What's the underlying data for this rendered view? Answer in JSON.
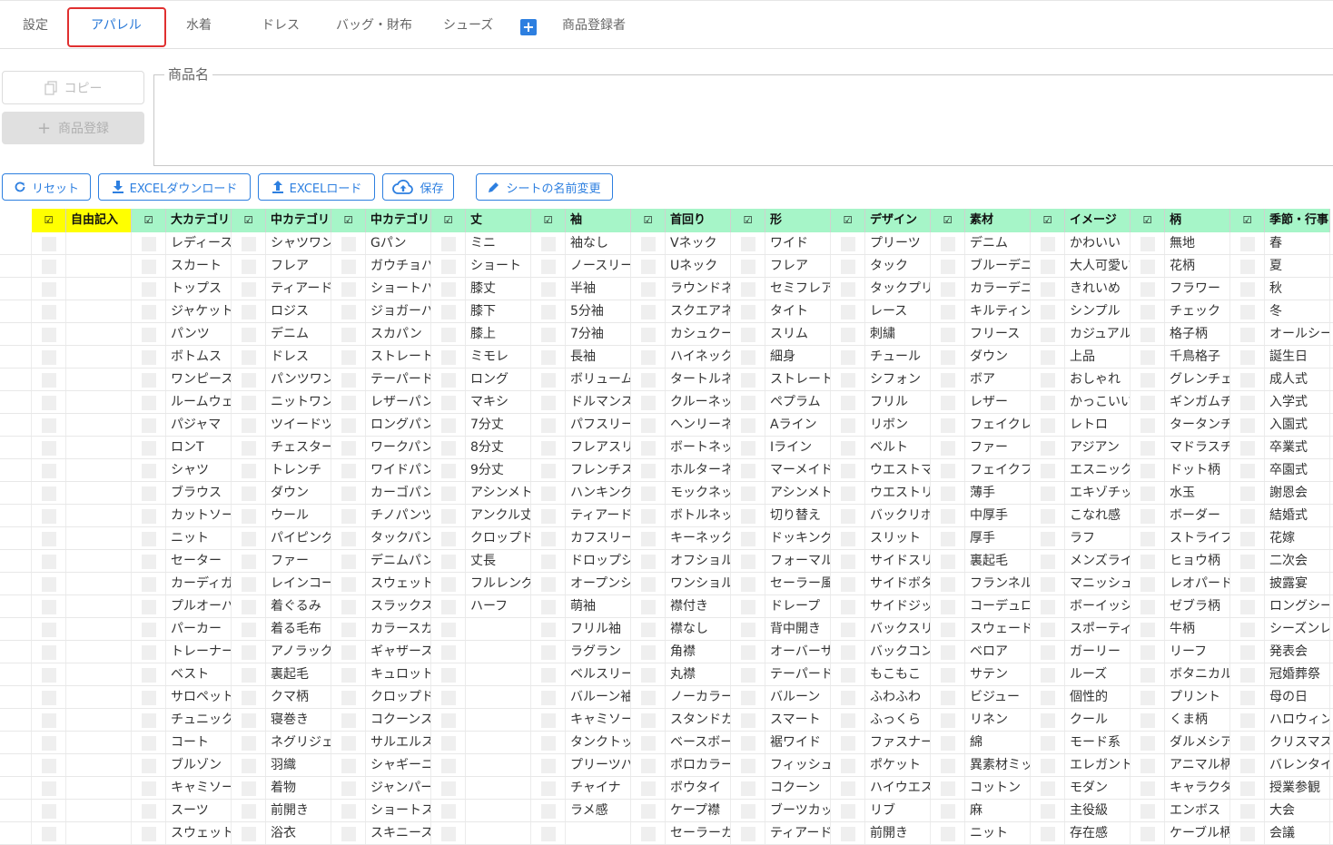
{
  "tabs": [
    "設定",
    "アパレル",
    "水着",
    "ドレス",
    "バッグ・財布",
    "シューズ",
    "商品登録者"
  ],
  "active_tab": "アパレル",
  "copy_label": "コピー",
  "register_label": "商品登録",
  "product_name_label": "商品名",
  "toolbar": {
    "reset": "リセット",
    "excel_download": "EXCELダウンロード",
    "excel_upload": "EXCELロード",
    "save": "保存",
    "rename_sheet": "シートの名前変更"
  },
  "check_mark": "☑",
  "headers": [
    "自由記入",
    "大カテゴリ",
    "中カテゴリ",
    "中カテゴリ",
    "丈",
    "袖",
    "首回り",
    "形",
    "デザイン",
    "素材",
    "イメージ",
    "柄",
    "季節・行事"
  ],
  "columns": [
    [],
    [
      "レディース",
      "スカート",
      "トップス",
      "ジャケット",
      "パンツ",
      "ボトムス",
      "ワンピース",
      "ルームウェ",
      "パジャマ",
      "ロンT",
      "シャツ",
      "ブラウス",
      "カットソー",
      "ニット",
      "セーター",
      "カーディガ",
      "プルオーバ",
      "パーカー",
      "トレーナー",
      "ベスト",
      "サロペット",
      "チュニック",
      "コート",
      "ブルゾン",
      "キャミソー",
      "スーツ",
      "スウェット"
    ],
    [
      "シャツワン",
      "フレア",
      "ティアード",
      "ロジス",
      "デニム",
      "ドレス",
      "パンツワン",
      "ニットワン",
      "ツイードツ",
      "チェスター",
      "トレンチ",
      "ダウン",
      "ウール",
      "パイピング",
      "ファー",
      "レインコー",
      "着ぐるみ",
      "着る毛布",
      "アノラック",
      "裏起毛",
      "クマ柄",
      "寝巻き",
      "ネグリジェ",
      "羽織",
      "着物",
      "前開き",
      "浴衣"
    ],
    [
      "Gパン",
      "ガウチョパ",
      "ショートパ",
      "ジョガーパ",
      "スカパン",
      "ストレート",
      "テーパード",
      "レザーパン",
      "ロングパン",
      "ワークパン",
      "ワイドパン",
      "カーゴパン",
      "チノパンツ",
      "タックパン",
      "デニムパン",
      "スウェット",
      "スラックス",
      "カラースカ",
      "ギャザース",
      "キュロット",
      "クロップド",
      "コクーンス",
      "サルエルス",
      "シャギーニ",
      "ジャンパー",
      "ショートス",
      "スキニース"
    ],
    [
      "ミニ",
      "ショート",
      "膝丈",
      "膝下",
      "膝上",
      "ミモレ",
      "ロング",
      "マキシ",
      "7分丈",
      "8分丈",
      "9分丈",
      "アシンメト",
      "アンクル丈",
      "クロップド",
      "丈長",
      "フルレング",
      "ハーフ"
    ],
    [
      "袖なし",
      "ノースリー",
      "半袖",
      "5分袖",
      "7分袖",
      "長袖",
      "ボリューム",
      "ドルマンス",
      "パフスリー",
      "フレアスリ",
      "フレンチス",
      "ハンキング",
      "ティアード",
      "カフスリー",
      "ドロップシ",
      "オープンシ",
      "萌袖",
      "フリル袖",
      "ラグラン",
      "ベルスリー",
      "バルーン袖",
      "キャミソー",
      "タンクトッ",
      "プリーツパ",
      "チャイナ",
      "ラメ感"
    ],
    [
      "Vネック",
      "Uネック",
      "ラウンドネ",
      "スクエアネ",
      "カシュクー",
      "ハイネック",
      "タートルネ",
      "クルーネッ",
      "ヘンリーネ",
      "ボートネッ",
      "ホルターネ",
      "モックネッ",
      "ボトルネッ",
      "キーネック",
      "オフショル",
      "ワンショル",
      "襟付き",
      "襟なし",
      "角襟",
      "丸襟",
      "ノーカラー",
      "スタンドカ",
      "ベースボー",
      "ポロカラー",
      "ボウタイ",
      "ケープ襟",
      "セーラーカ"
    ],
    [
      "ワイド",
      "フレア",
      "セミフレア",
      "タイト",
      "スリム",
      "細身",
      "ストレート",
      "ペプラム",
      "Aライン",
      "Iライン",
      "マーメイド",
      "アシンメト",
      "切り替え",
      "ドッキング",
      "フォーマル",
      "セーラー風",
      "ドレープ",
      "背中開き",
      "オーバーサ",
      "テーパード",
      "バルーン",
      "スマート",
      "裾ワイド",
      "フィッシュ",
      "コクーン",
      "ブーツカッ",
      "ティアード"
    ],
    [
      "プリーツ",
      "タック",
      "タックプリ",
      "レース",
      "刺繍",
      "チュール",
      "シフォン",
      "フリル",
      "リボン",
      "ベルト",
      "ウエストマ",
      "ウエストリ",
      "バックリボ",
      "スリット",
      "サイドスリ",
      "サイドボタ",
      "サイドジッ",
      "バックスリ",
      "バックコン",
      "もこもこ",
      "ふわふわ",
      "ふっくら",
      "ファスナー",
      "ポケット",
      "ハイウエス",
      "リブ",
      "前開き"
    ],
    [
      "デニム",
      "ブルーデニ",
      "カラーデニ",
      "キルティン",
      "フリース",
      "ダウン",
      "ボア",
      "レザー",
      "フェイクレ",
      "ファー",
      "フェイクフ",
      "薄手",
      "中厚手",
      "厚手",
      "裏起毛",
      "フランネル",
      "コーデュロ",
      "スウェード",
      "ベロア",
      "サテン",
      "ビジュー",
      "リネン",
      "綿",
      "異素材ミッ",
      "コットン",
      "麻",
      "ニット"
    ],
    [
      "かわいい",
      "大人可愛い",
      "きれいめ",
      "シンプル",
      "カジュアル",
      "上品",
      "おしゃれ",
      "かっこいい",
      "レトロ",
      "アジアン",
      "エスニック",
      "エキゾチッ",
      "こなれ感",
      "ラフ",
      "メンズライ",
      "マニッシュ",
      "ボーイッシ",
      "スポーティ",
      "ガーリー",
      "ルーズ",
      "個性的",
      "クール",
      "モード系",
      "エレガント",
      "モダン",
      "主役級",
      "存在感"
    ],
    [
      "無地",
      "花柄",
      "フラワー",
      "チェック",
      "格子柄",
      "千鳥格子",
      "グレンチェ",
      "ギンガムチ",
      "タータンチ",
      "マドラスチ",
      "ドット柄",
      "水玉",
      "ボーダー",
      "ストライプ",
      "ヒョウ柄",
      "レオパード",
      "ゼブラ柄",
      "牛柄",
      "リーフ",
      "ボタニカル",
      "プリント",
      "くま柄",
      "ダルメシア",
      "アニマル柄",
      "キャラクタ",
      "エンボス",
      "ケーブル柄"
    ],
    [
      "春",
      "夏",
      "秋",
      "冬",
      "オールシー",
      "誕生日",
      "成人式",
      "入学式",
      "入園式",
      "卒業式",
      "卒園式",
      "謝恩会",
      "結婚式",
      "花嫁",
      "二次会",
      "披露宴",
      "ロングシー",
      "シーズンレ",
      "発表会",
      "冠婚葬祭",
      "母の日",
      "ハロウィン",
      "クリスマス",
      "バレンタイ",
      "授業参観",
      "大会",
      "会議"
    ]
  ]
}
